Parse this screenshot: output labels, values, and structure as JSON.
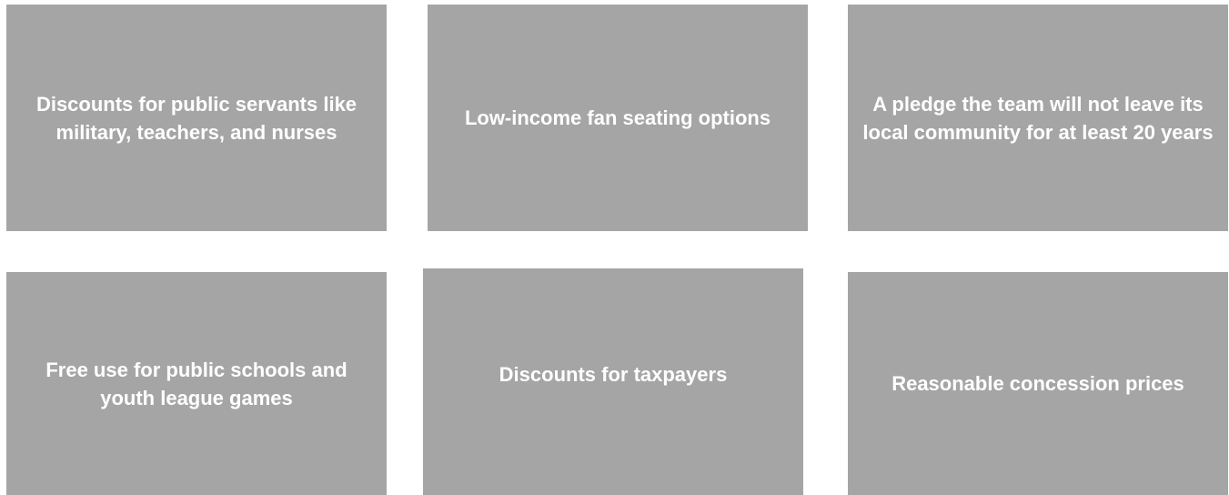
{
  "tiles": [
    {
      "label": "Discounts for public servants like military, teachers, and nurses"
    },
    {
      "label": "Low-income fan seating options"
    },
    {
      "label": "A pledge the team will not leave its local community for at least 20 years"
    },
    {
      "label": "Free use for public schools and youth league games"
    },
    {
      "label": "Discounts for taxpayers"
    },
    {
      "label": "Reasonable concession prices"
    }
  ],
  "colors": {
    "tile_background": "#a5a5a5",
    "tile_text": "#ffffff",
    "page_background": "#ffffff"
  }
}
